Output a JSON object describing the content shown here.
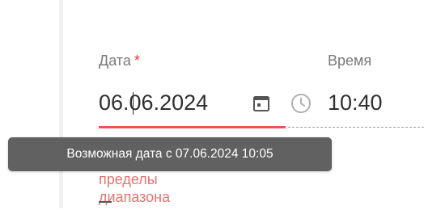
{
  "form": {
    "date": {
      "label": "Дата",
      "required_marker": "*",
      "value": "06.06.2024",
      "icon": "calendar-icon"
    },
    "time": {
      "label": "Время",
      "value": "10:40",
      "icon": "clock-icon"
    },
    "error": {
      "line1": "пределы",
      "line2": "диапазона"
    }
  },
  "tooltip": {
    "text": "Возможная дата с 07.06.2024 10:05"
  },
  "colors": {
    "error": "#ef5350",
    "tooltip_bg": "#616161",
    "required": "#e53935"
  }
}
